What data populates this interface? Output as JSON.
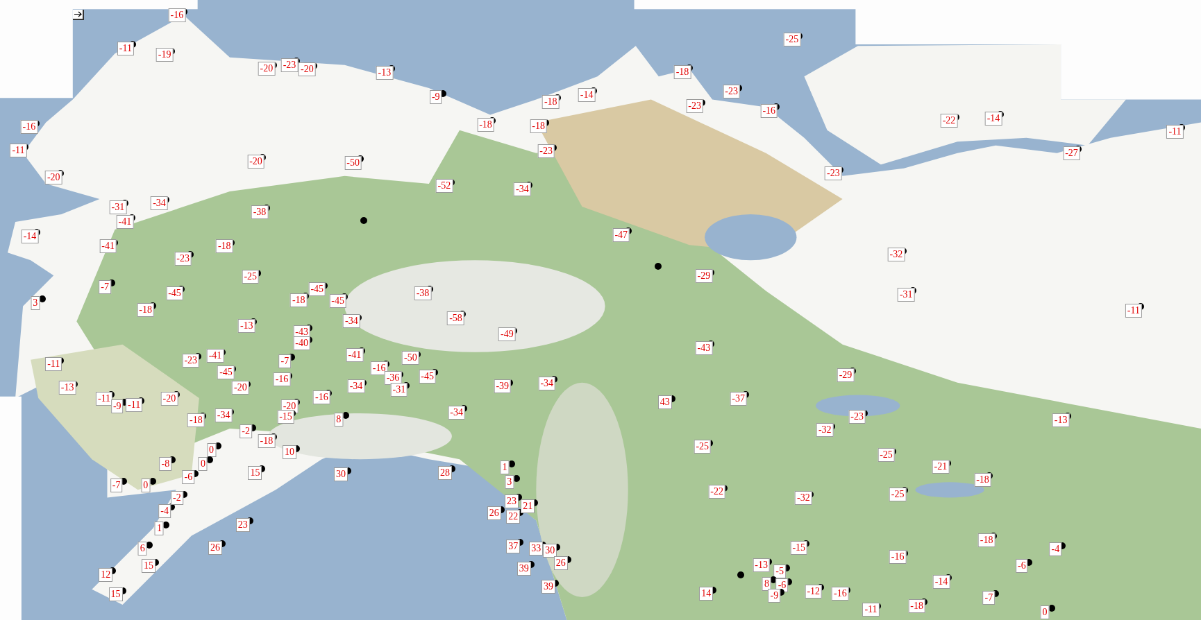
{
  "map": {
    "stations": [
      {
        "kind": "label",
        "temp": "-16"
      },
      {
        "kind": "label",
        "temp": "-25"
      },
      {
        "kind": "label",
        "temp": "-11"
      },
      {
        "kind": "label",
        "temp": "-19"
      },
      {
        "kind": "label",
        "temp": "-20"
      },
      {
        "kind": "label",
        "temp": "-23"
      },
      {
        "kind": "label",
        "temp": "-20"
      },
      {
        "kind": "label",
        "temp": "-13"
      },
      {
        "kind": "label",
        "temp": "-18"
      },
      {
        "kind": "label",
        "temp": "-9"
      },
      {
        "kind": "label",
        "temp": "-14"
      },
      {
        "kind": "label",
        "temp": "-23"
      },
      {
        "kind": "label",
        "temp": "-18"
      },
      {
        "kind": "label",
        "temp": "-23"
      },
      {
        "kind": "label",
        "temp": "-16"
      },
      {
        "kind": "label",
        "temp": "-22"
      },
      {
        "kind": "label",
        "temp": "-14"
      },
      {
        "kind": "label",
        "temp": "-16"
      },
      {
        "kind": "label",
        "temp": "-18"
      },
      {
        "kind": "label",
        "temp": "-18"
      },
      {
        "kind": "label",
        "temp": "-11"
      },
      {
        "kind": "label",
        "temp": "-11"
      },
      {
        "kind": "label",
        "temp": "-23"
      },
      {
        "kind": "label",
        "temp": "-27"
      },
      {
        "kind": "label",
        "temp": "-20"
      },
      {
        "kind": "label",
        "temp": "-50"
      },
      {
        "kind": "label",
        "temp": "-20"
      },
      {
        "kind": "label",
        "temp": "-23"
      },
      {
        "kind": "label",
        "temp": "-52"
      },
      {
        "kind": "label",
        "temp": "-34"
      },
      {
        "kind": "label",
        "temp": "-31"
      },
      {
        "kind": "label",
        "temp": "-34"
      },
      {
        "kind": "label",
        "temp": "-38"
      },
      {
        "kind": "label",
        "temp": "-41"
      },
      {
        "kind": "dot"
      },
      {
        "kind": "label",
        "temp": "-14"
      },
      {
        "kind": "label",
        "temp": "-47"
      },
      {
        "kind": "label",
        "temp": "-41"
      },
      {
        "kind": "label",
        "temp": "-18"
      },
      {
        "kind": "label",
        "temp": "-23"
      },
      {
        "kind": "label",
        "temp": "-32"
      },
      {
        "kind": "dot"
      },
      {
        "kind": "label",
        "temp": "-25"
      },
      {
        "kind": "label",
        "temp": "-29"
      },
      {
        "kind": "label",
        "temp": "-7"
      },
      {
        "kind": "label",
        "temp": "-45"
      },
      {
        "kind": "label",
        "temp": "-45"
      },
      {
        "kind": "label",
        "temp": "-38"
      },
      {
        "kind": "label",
        "temp": "3"
      },
      {
        "kind": "label",
        "temp": "-18"
      },
      {
        "kind": "label",
        "temp": "-45"
      },
      {
        "kind": "label",
        "temp": "-31"
      },
      {
        "kind": "label",
        "temp": "-18"
      },
      {
        "kind": "label",
        "temp": "-11"
      },
      {
        "kind": "label",
        "temp": "-13"
      },
      {
        "kind": "label",
        "temp": "-34"
      },
      {
        "kind": "label",
        "temp": "-58"
      },
      {
        "kind": "label",
        "temp": "-43"
      },
      {
        "kind": "label",
        "temp": "-49"
      },
      {
        "kind": "label",
        "temp": "-40"
      },
      {
        "kind": "label",
        "temp": "-43"
      },
      {
        "kind": "label",
        "temp": "-11"
      },
      {
        "kind": "label",
        "temp": "-23"
      },
      {
        "kind": "label",
        "temp": "-41"
      },
      {
        "kind": "label",
        "temp": "-7"
      },
      {
        "kind": "label",
        "temp": "-41"
      },
      {
        "kind": "label",
        "temp": "-50"
      },
      {
        "kind": "label",
        "temp": "-45"
      },
      {
        "kind": "label",
        "temp": "-16"
      },
      {
        "kind": "label",
        "temp": "-16"
      },
      {
        "kind": "label",
        "temp": "-36"
      },
      {
        "kind": "label",
        "temp": "-45"
      },
      {
        "kind": "label",
        "temp": "-29"
      },
      {
        "kind": "label",
        "temp": "-13"
      },
      {
        "kind": "label",
        "temp": "-20"
      },
      {
        "kind": "label",
        "temp": "-34"
      },
      {
        "kind": "label",
        "temp": "-31"
      },
      {
        "kind": "label",
        "temp": "-39"
      },
      {
        "kind": "label",
        "temp": "-34"
      },
      {
        "kind": "label",
        "temp": "-11"
      },
      {
        "kind": "label",
        "temp": "-20"
      },
      {
        "kind": "label",
        "temp": "-16"
      },
      {
        "kind": "label",
        "temp": "43"
      },
      {
        "kind": "label",
        "temp": "-37"
      },
      {
        "kind": "label",
        "temp": "-9"
      },
      {
        "kind": "label",
        "temp": "-11"
      },
      {
        "kind": "label",
        "temp": "-20"
      },
      {
        "kind": "label",
        "temp": "-18"
      },
      {
        "kind": "label",
        "temp": "-34"
      },
      {
        "kind": "label",
        "temp": "-15"
      },
      {
        "kind": "label",
        "temp": "8"
      },
      {
        "kind": "label",
        "temp": "-34"
      },
      {
        "kind": "label",
        "temp": "-23"
      },
      {
        "kind": "label",
        "temp": "-13"
      },
      {
        "kind": "label",
        "temp": "-2"
      },
      {
        "kind": "label",
        "temp": "-32"
      },
      {
        "kind": "label",
        "temp": "0"
      },
      {
        "kind": "label",
        "temp": "-18"
      },
      {
        "kind": "label",
        "temp": "10"
      },
      {
        "kind": "label",
        "temp": "-25"
      },
      {
        "kind": "label",
        "temp": "-25"
      },
      {
        "kind": "label",
        "temp": "-7"
      },
      {
        "kind": "label",
        "temp": "0"
      },
      {
        "kind": "label",
        "temp": "-8"
      },
      {
        "kind": "label",
        "temp": "-6"
      },
      {
        "kind": "label",
        "temp": "0"
      },
      {
        "kind": "label",
        "temp": "15"
      },
      {
        "kind": "label",
        "temp": "30"
      },
      {
        "kind": "label",
        "temp": "28"
      },
      {
        "kind": "label",
        "temp": "1"
      },
      {
        "kind": "label",
        "temp": "3"
      },
      {
        "kind": "label",
        "temp": "-21"
      },
      {
        "kind": "label",
        "temp": "-18"
      },
      {
        "kind": "label",
        "temp": "-4"
      },
      {
        "kind": "label",
        "temp": "-2"
      },
      {
        "kind": "label",
        "temp": "26"
      },
      {
        "kind": "label",
        "temp": "23"
      },
      {
        "kind": "label",
        "temp": "22"
      },
      {
        "kind": "label",
        "temp": "21"
      },
      {
        "kind": "label",
        "temp": "-22"
      },
      {
        "kind": "label",
        "temp": "-32"
      },
      {
        "kind": "label",
        "temp": "-25"
      },
      {
        "kind": "label",
        "temp": "1"
      },
      {
        "kind": "label",
        "temp": "23"
      },
      {
        "kind": "label",
        "temp": "6"
      },
      {
        "kind": "label",
        "temp": "26"
      },
      {
        "kind": "label",
        "temp": "37"
      },
      {
        "kind": "label",
        "temp": "33"
      },
      {
        "kind": "label",
        "temp": "30"
      },
      {
        "kind": "label",
        "temp": "-15"
      },
      {
        "kind": "label",
        "temp": "-18"
      },
      {
        "kind": "label",
        "temp": "-4"
      },
      {
        "kind": "label",
        "temp": "12"
      },
      {
        "kind": "label",
        "temp": "15"
      },
      {
        "kind": "label",
        "temp": "39"
      },
      {
        "kind": "label",
        "temp": "26"
      },
      {
        "kind": "dot"
      },
      {
        "kind": "label",
        "temp": "-13"
      },
      {
        "kind": "label",
        "temp": "-5"
      },
      {
        "kind": "label",
        "temp": "-16"
      },
      {
        "kind": "label",
        "temp": "-6"
      },
      {
        "kind": "label",
        "temp": "39"
      },
      {
        "kind": "label",
        "temp": "8"
      },
      {
        "kind": "label",
        "temp": "-6"
      },
      {
        "kind": "label",
        "temp": "-14"
      },
      {
        "kind": "label",
        "temp": "15"
      },
      {
        "kind": "label",
        "temp": "14"
      },
      {
        "kind": "label",
        "temp": "-9"
      },
      {
        "kind": "label",
        "temp": "-12"
      },
      {
        "kind": "label",
        "temp": "-16"
      },
      {
        "kind": "label",
        "temp": "-7"
      },
      {
        "kind": "label",
        "temp": "-11"
      },
      {
        "kind": "label",
        "temp": "-18"
      },
      {
        "kind": "label",
        "temp": "0"
      }
    ]
  }
}
